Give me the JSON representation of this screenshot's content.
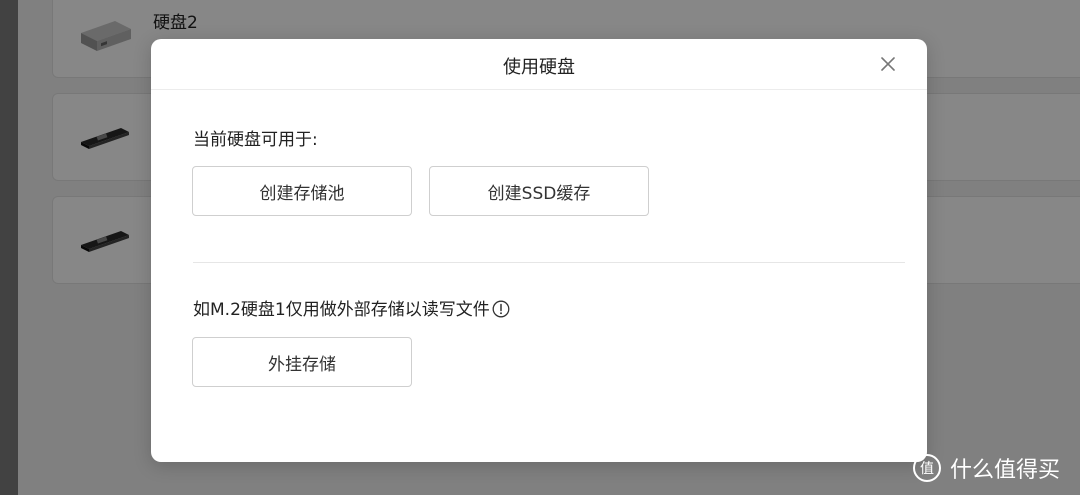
{
  "background": {
    "cards": [
      {
        "title": "硬盘2",
        "icon": "hdd-icon"
      },
      {
        "title": "",
        "icon": "m2-ssd-icon"
      },
      {
        "title": "",
        "icon": "m2-ssd-icon"
      }
    ]
  },
  "dialog": {
    "title": "使用硬盘",
    "close_icon": "close-icon",
    "section1": {
      "label": "当前硬盘可用于:",
      "buttons": [
        "创建存储池",
        "创建SSD缓存"
      ]
    },
    "section2": {
      "label": "如M.2硬盘1仅用做外部存储以读写文件",
      "info_icon": "info-icon",
      "button": "外挂存储"
    }
  },
  "watermark": {
    "text": "什么值得买",
    "icon": "smzdm-logo-icon"
  },
  "colors": {
    "overlay": "#000000",
    "dialog_bg": "#ffffff",
    "button_border": "#cfcfcf"
  }
}
